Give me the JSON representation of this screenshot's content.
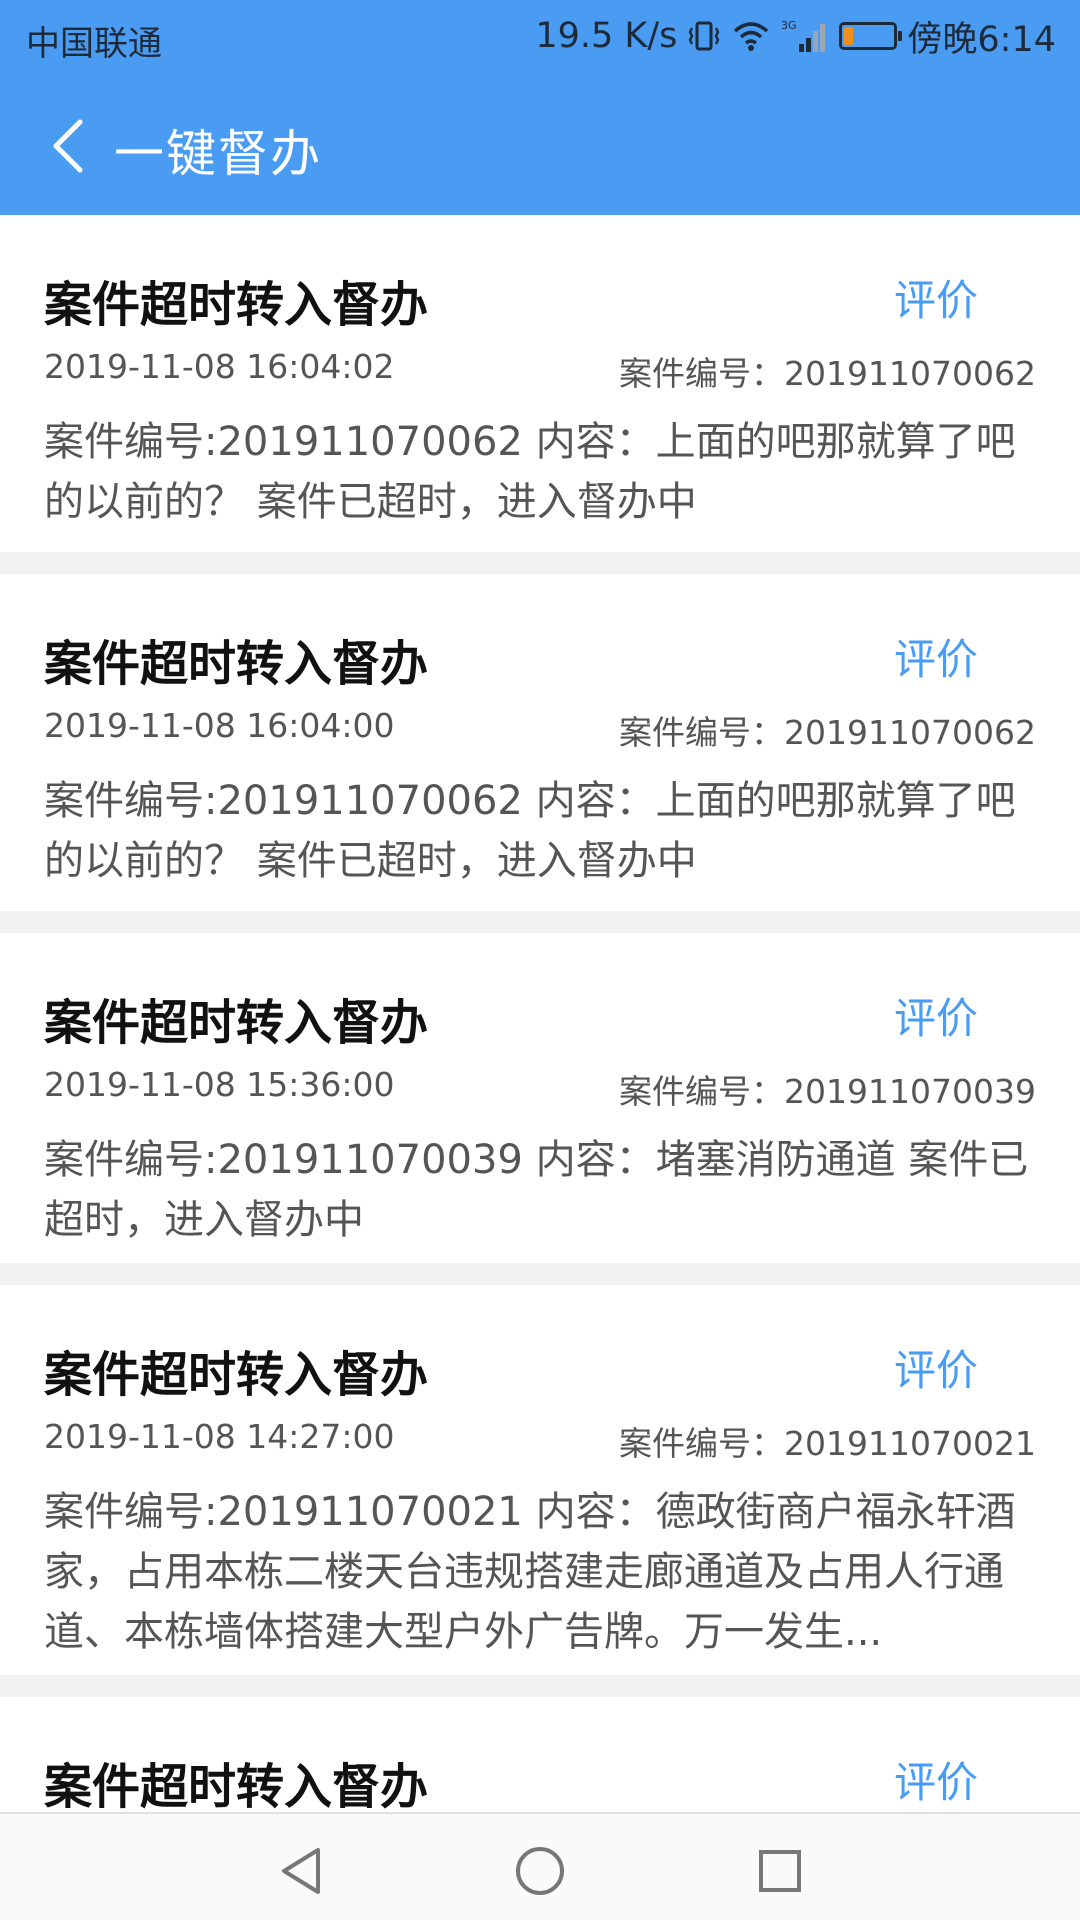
{
  "status_bar": {
    "carrier": "中国联通",
    "net_speed": "19.5 K/s",
    "network_type": "3G",
    "time": "傍晚6:14",
    "battery_color": "#f09018"
  },
  "app_bar": {
    "title": "一键督办",
    "back_icon": "chevron-left-icon",
    "background": "#4a9bf2"
  },
  "items": [
    {
      "title": "案件超时转入督办",
      "action": "评价",
      "date": "2019-11-08 16:04:02",
      "case_number": "案件编号：201911070062",
      "content": "案件编号:201911070062 内容：上面的吧那就算了吧的以前的？ 案件已超时，进入督办中"
    },
    {
      "title": "案件超时转入督办",
      "action": "评价",
      "date": "2019-11-08 16:04:00",
      "case_number": "案件编号：201911070062",
      "content": "案件编号:201911070062 内容：上面的吧那就算了吧的以前的？ 案件已超时，进入督办中"
    },
    {
      "title": "案件超时转入督办",
      "action": "评价",
      "date": "2019-11-08 15:36:00",
      "case_number": "案件编号：201911070039",
      "content": "案件编号:201911070039 内容：堵塞消防通道 案件已超时，进入督办中"
    },
    {
      "title": "案件超时转入督办",
      "action": "评价",
      "date": "2019-11-08 14:27:00",
      "case_number": "案件编号：201911070021",
      "content": "案件编号:201911070021 内容：德政街商户福永轩酒家，占用本栋二楼天台违规搭建走廊通道及占用人行通道、本栋墙体搭建大型户外广告牌。万一发生..."
    },
    {
      "title": "案件超时转入督办",
      "action": "评价"
    }
  ],
  "nav_bar": {
    "back_icon": "triangle-back-icon",
    "home_icon": "circle-home-icon",
    "recents_icon": "square-recents-icon"
  }
}
